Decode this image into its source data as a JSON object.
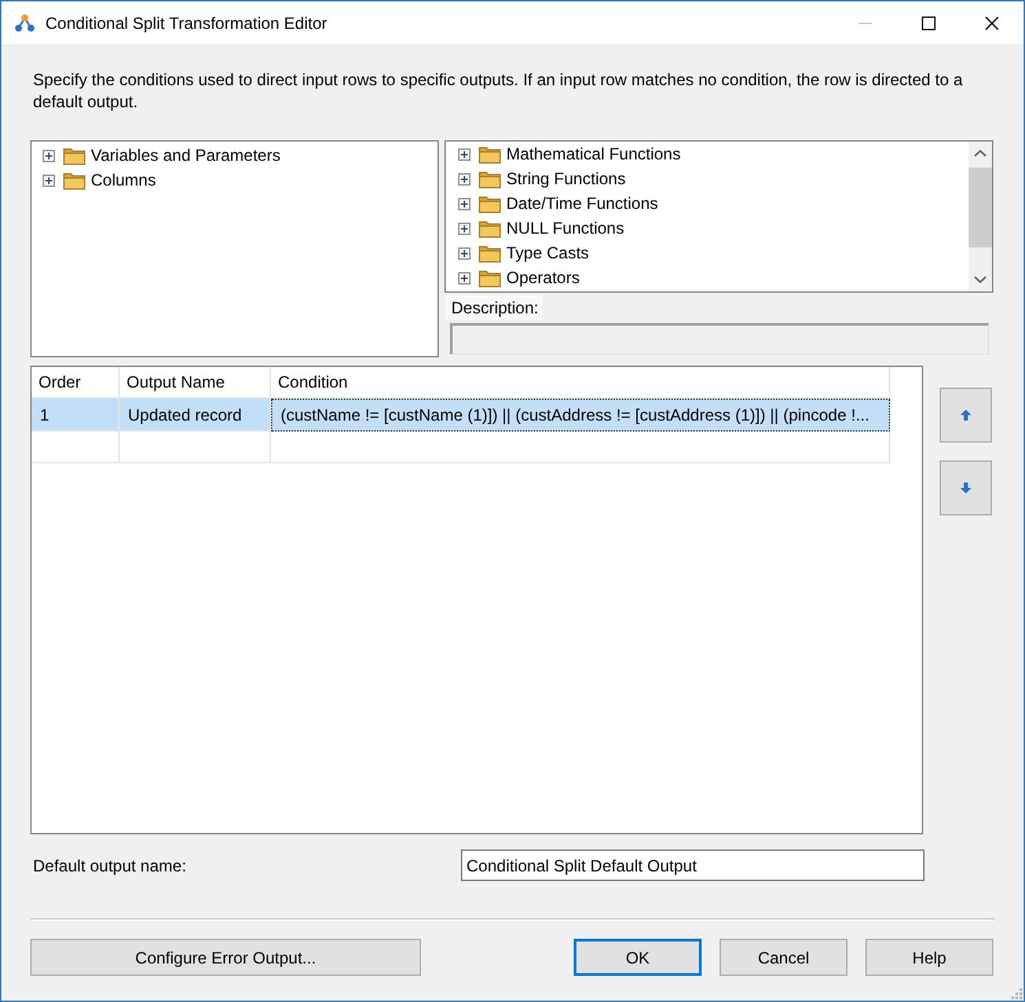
{
  "window": {
    "title": "Conditional Split Transformation Editor",
    "controls": [
      {
        "kind": "minimize",
        "disabled": true
      },
      {
        "kind": "maximize",
        "disabled": false
      },
      {
        "kind": "close",
        "disabled": false
      }
    ]
  },
  "instructions": "Specify the conditions used to direct input rows to specific outputs. If an input row matches no condition, the row is directed to a default output.",
  "variables_tree": {
    "items": [
      {
        "label": "Variables and Parameters",
        "expanded": false
      },
      {
        "label": "Columns",
        "expanded": false
      }
    ]
  },
  "functions_tree": {
    "items": [
      {
        "label": "Mathematical Functions",
        "expanded": false
      },
      {
        "label": "String Functions",
        "expanded": false
      },
      {
        "label": "Date/Time Functions",
        "expanded": false
      },
      {
        "label": "NULL Functions",
        "expanded": false
      },
      {
        "label": "Type Casts",
        "expanded": false
      },
      {
        "label": "Operators",
        "expanded": false
      }
    ]
  },
  "description": {
    "label": "Description:"
  },
  "conditions_grid": {
    "columns": [
      "Order",
      "Output Name",
      "Condition"
    ],
    "rows": [
      {
        "selected": true,
        "cells": [
          {
            "text": "1",
            "focused": false
          },
          {
            "text": "Updated record",
            "focused": false
          },
          {
            "text": "(custName != [custName (1)]) || (custAddress != [custAddress (1)]) || (pincode !...",
            "focused": true
          }
        ]
      }
    ]
  },
  "default_output": {
    "label": "Default output name:",
    "value": "Conditional Split Default Output"
  },
  "error_button": {
    "label": "Configure Error Output..."
  },
  "dialog_buttons": [
    {
      "label": "OK",
      "default": true
    },
    {
      "label": "Cancel",
      "default": false
    },
    {
      "label": "Help",
      "default": false
    }
  ]
}
